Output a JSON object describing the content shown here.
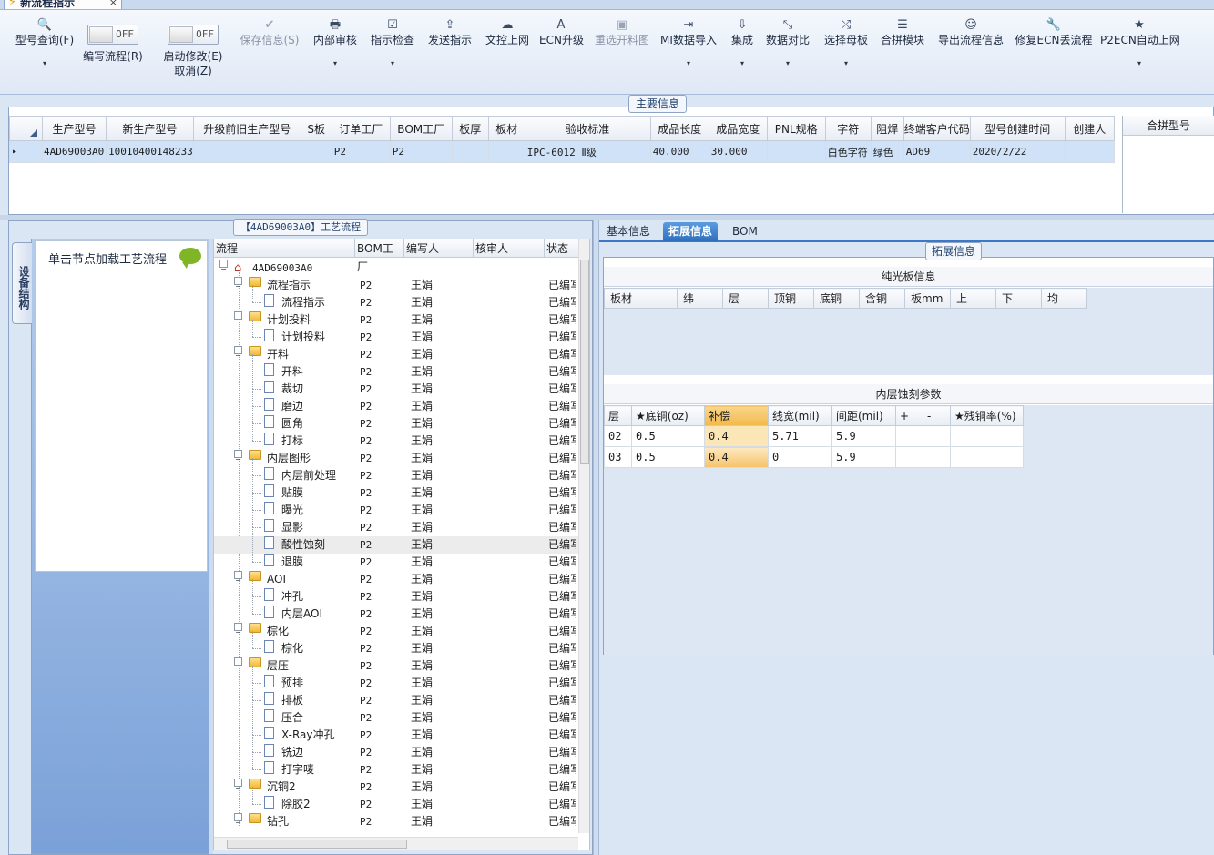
{
  "window": {
    "tab_title": "新流程指示",
    "close_glyph": "×"
  },
  "toolbar": {
    "items": [
      {
        "id": "query",
        "icon": "search-icon",
        "glyph": "🔍",
        "label": "型号查询(F)",
        "dropdown": true,
        "disabled": false
      },
      {
        "id": "save",
        "icon": "check-icon",
        "glyph": "✔",
        "label": "保存信息(S)",
        "disabled": true
      },
      {
        "id": "audit",
        "icon": "printer-icon",
        "glyph": "🖶",
        "label": "内部审核",
        "dropdown": true,
        "disabled": false
      },
      {
        "id": "check",
        "icon": "checkbox-icon",
        "glyph": "☑",
        "label": "指示检查",
        "dropdown": true,
        "disabled": false
      },
      {
        "id": "send",
        "icon": "upload-icon",
        "glyph": "⇪",
        "label": "发送指示",
        "disabled": false
      },
      {
        "id": "docup",
        "icon": "cloud-upload-icon",
        "glyph": "☁",
        "label": "文控上网",
        "disabled": false
      },
      {
        "id": "ecn",
        "icon": "font-icon",
        "glyph": "A",
        "label": "ECN升级",
        "disabled": false
      },
      {
        "id": "reselect",
        "icon": "image-icon",
        "glyph": "▣",
        "label": "重选开料图",
        "disabled": true
      },
      {
        "id": "mi_import",
        "icon": "import-icon",
        "glyph": "⇥",
        "label": "MI数据导入",
        "dropdown": true,
        "disabled": false
      },
      {
        "id": "integrate",
        "icon": "download-icon",
        "glyph": "⇩",
        "label": "集成",
        "dropdown": true,
        "disabled": false
      },
      {
        "id": "compare",
        "icon": "compress-icon",
        "glyph": "⤡",
        "label": "数据对比",
        "dropdown": true,
        "disabled": false
      },
      {
        "id": "master",
        "icon": "shuffle-icon",
        "glyph": "⤮",
        "label": "选择母板",
        "dropdown": true,
        "disabled": false
      },
      {
        "id": "combine",
        "icon": "list-icon",
        "glyph": "☰",
        "label": "合拼模块",
        "disabled": false
      },
      {
        "id": "export",
        "icon": "smile-icon",
        "glyph": "☺",
        "label": "导出流程信息",
        "disabled": false
      },
      {
        "id": "repair",
        "icon": "wrench-icon",
        "glyph": "🔧",
        "label": "修复ECN丢流程",
        "disabled": false
      },
      {
        "id": "p2ecn",
        "icon": "star-icon",
        "glyph": "★",
        "label": "P2ECN自动上网",
        "dropdown": true,
        "disabled": false
      }
    ],
    "toggle_write": {
      "state": "OFF",
      "label": "编写流程(R)"
    },
    "toggle_modify": {
      "state": "OFF",
      "label": "启动修改(E)",
      "sub": "取消(Z)"
    },
    "dropdown_glyph": "▾"
  },
  "main_info": {
    "title": "主要信息",
    "columns": [
      "生产型号",
      "新生产型号",
      "升级前旧生产型号",
      "S板",
      "订单工厂",
      "BOM工厂",
      "板厚",
      "板材",
      "验收标准",
      "成品长度",
      "成品宽度",
      "PNL规格",
      "字符",
      "阻焊",
      "终端客户代码",
      "型号创建时间",
      "创建人"
    ],
    "rows": [
      [
        "4AD69003A0",
        "10010400148233",
        "",
        "",
        "P2",
        "P2",
        "",
        "",
        "IPC-6012 Ⅱ级",
        "40.000",
        "30.000",
        "",
        "白色字符",
        "绿色",
        "AD69",
        "2020/2/22",
        ""
      ]
    ],
    "row_marker": "▸",
    "combine_header": "合拼型号"
  },
  "process": {
    "title": "【4AD69003A0】工艺流程",
    "side_tab": "设备结构",
    "hint": "单击节点加载工艺流程",
    "columns": [
      "流程",
      "BOM工厂",
      "编写人",
      "核审人",
      "状态"
    ],
    "root": "4AD69003A0",
    "nodes": [
      {
        "level": 1,
        "type": "folder",
        "name": "流程指示",
        "bom": "P2",
        "writer": "王娟",
        "status": "已编写"
      },
      {
        "level": 2,
        "type": "doc",
        "name": "流程指示",
        "bom": "P2",
        "writer": "王娟",
        "status": "已编写"
      },
      {
        "level": 1,
        "type": "folder",
        "name": "计划投料",
        "bom": "P2",
        "writer": "王娟",
        "status": "已编写"
      },
      {
        "level": 2,
        "type": "doc",
        "name": "计划投料",
        "bom": "P2",
        "writer": "王娟",
        "status": "已编写"
      },
      {
        "level": 1,
        "type": "folder",
        "name": "开料",
        "bom": "P2",
        "writer": "王娟",
        "status": "已编写"
      },
      {
        "level": 2,
        "type": "doc",
        "name": "开料",
        "bom": "P2",
        "writer": "王娟",
        "status": "已编写"
      },
      {
        "level": 2,
        "type": "doc",
        "name": "裁切",
        "bom": "P2",
        "writer": "王娟",
        "status": "已编写"
      },
      {
        "level": 2,
        "type": "doc",
        "name": "磨边",
        "bom": "P2",
        "writer": "王娟",
        "status": "已编写"
      },
      {
        "level": 2,
        "type": "doc",
        "name": "圆角",
        "bom": "P2",
        "writer": "王娟",
        "status": "已编写"
      },
      {
        "level": 2,
        "type": "doc",
        "name": "打标",
        "bom": "P2",
        "writer": "王娟",
        "status": "已编写"
      },
      {
        "level": 1,
        "type": "folder",
        "name": "内层图形",
        "bom": "P2",
        "writer": "王娟",
        "status": "已编写"
      },
      {
        "level": 2,
        "type": "doc",
        "name": "内层前处理",
        "bom": "P2",
        "writer": "王娟",
        "status": "已编写"
      },
      {
        "level": 2,
        "type": "doc",
        "name": "贴膜",
        "bom": "P2",
        "writer": "王娟",
        "status": "已编写"
      },
      {
        "level": 2,
        "type": "doc",
        "name": "曝光",
        "bom": "P2",
        "writer": "王娟",
        "status": "已编写"
      },
      {
        "level": 2,
        "type": "doc",
        "name": "显影",
        "bom": "P2",
        "writer": "王娟",
        "status": "已编写"
      },
      {
        "level": 2,
        "type": "doc",
        "name": "酸性蚀刻",
        "bom": "P2",
        "writer": "王娟",
        "status": "已编写",
        "selected": true
      },
      {
        "level": 2,
        "type": "doc",
        "name": "退膜",
        "bom": "P2",
        "writer": "王娟",
        "status": "已编写"
      },
      {
        "level": 1,
        "type": "folder",
        "name": "AOI",
        "bom": "P2",
        "writer": "王娟",
        "status": "已编写"
      },
      {
        "level": 2,
        "type": "doc",
        "name": "冲孔",
        "bom": "P2",
        "writer": "王娟",
        "status": "已编写"
      },
      {
        "level": 2,
        "type": "doc",
        "name": "内层AOI",
        "bom": "P2",
        "writer": "王娟",
        "status": "已编写"
      },
      {
        "level": 1,
        "type": "folder",
        "name": "棕化",
        "bom": "P2",
        "writer": "王娟",
        "status": "已编写"
      },
      {
        "level": 2,
        "type": "doc",
        "name": "棕化",
        "bom": "P2",
        "writer": "王娟",
        "status": "已编写"
      },
      {
        "level": 1,
        "type": "folder",
        "name": "层压",
        "bom": "P2",
        "writer": "王娟",
        "status": "已编写"
      },
      {
        "level": 2,
        "type": "doc",
        "name": "预排",
        "bom": "P2",
        "writer": "王娟",
        "status": "已编写"
      },
      {
        "level": 2,
        "type": "doc",
        "name": "排板",
        "bom": "P2",
        "writer": "王娟",
        "status": "已编写"
      },
      {
        "level": 2,
        "type": "doc",
        "name": "压合",
        "bom": "P2",
        "writer": "王娟",
        "status": "已编写"
      },
      {
        "level": 2,
        "type": "doc",
        "name": "X-Ray冲孔",
        "bom": "P2",
        "writer": "王娟",
        "status": "已编写"
      },
      {
        "level": 2,
        "type": "doc",
        "name": "铣边",
        "bom": "P2",
        "writer": "王娟",
        "status": "已编写"
      },
      {
        "level": 2,
        "type": "doc",
        "name": "打字唛",
        "bom": "P2",
        "writer": "王娟",
        "status": "已编写"
      },
      {
        "level": 1,
        "type": "folder",
        "name": "沉铜2",
        "bom": "P2",
        "writer": "王娟",
        "status": "已编写"
      },
      {
        "level": 2,
        "type": "doc",
        "name": "除胶2",
        "bom": "P2",
        "writer": "王娟",
        "status": "已编写"
      },
      {
        "level": 1,
        "type": "folder",
        "name": "钻孔",
        "bom": "P2",
        "writer": "王娟",
        "status": "已编写"
      }
    ]
  },
  "right": {
    "tabs": [
      "基本信息",
      "拓展信息",
      "BOM"
    ],
    "active_tab": 1,
    "ext_title": "拓展信息",
    "plain_board": {
      "title": "纯光板信息",
      "columns": [
        "板材",
        "纬",
        "层",
        "顶铜",
        "底铜",
        "含铜",
        "板mm",
        "上",
        "下",
        "均"
      ]
    },
    "etch": {
      "title": "内层蚀刻参数",
      "columns": [
        "层",
        "★底铜(oz)",
        "补偿",
        "线宽(mil)",
        "间距(mil)",
        "+",
        "-",
        "★残铜率(%)"
      ],
      "rows": [
        [
          "02",
          "0.5",
          "0.4",
          "5.71",
          "5.9",
          "",
          "",
          ""
        ],
        [
          "03",
          "0.5",
          "0.4",
          "0",
          "5.9",
          "",
          "",
          ""
        ]
      ]
    }
  }
}
